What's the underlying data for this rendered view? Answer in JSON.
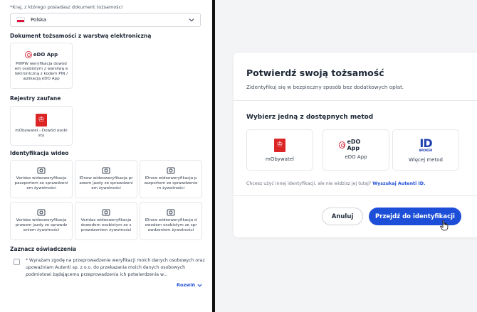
{
  "left": {
    "country_label": "*Kraj, z którego posiadasz dokument tożsamości",
    "country_value": "Polska",
    "section_eid": "Dokument tożsamości z warstwą elektroniczną",
    "edo_tile": {
      "logo_text": "eDO App",
      "text": "PWPW weryfikacja dowod em osobistym z warstwą e lektroniczną z kodem PIN / aplikacją eDO App"
    },
    "section_trusted": "Rejestry zaufane",
    "mobywatel_tile": {
      "text": "mObywatel - Dowód osobi sty"
    },
    "section_video": "Identyfikacja wideo",
    "video_tiles": [
      "Veridas wideoweryfikacja paszportem ze sprawdzeni em żywotności",
      "IDnow wideoweryfikacja pr awem jazdy ze sprawdzeni em żywotności",
      "IDnow wideoweryfikacja p aszportem ze sprawdzenie m żywotności",
      "Veridas wideoweryfikacja prawem jazdy ze sprawdz eniem żywotności",
      "Veridas wideoweryfikacja dowodem osobistym ze s prawdzeniem żywotności",
      "IDnow wideoweryfikacja d owodem osobistym ze spr awdzeniem żywotności"
    ],
    "section_consents": "Zaznacz oświadczenia",
    "consent_text": "* Wyrażam zgodę na przeprowadzenie weryfikacji moich danych osobowych oraz upoważniam Autenti sp. z o.o. do przekazania moich danych osobowych podmiotowi żądającemu przeprowadzenia ich potwierdzenia w...",
    "expand_label": "Rozwiń"
  },
  "modal": {
    "title": "Potwierdź swoją tożsamość",
    "subtitle": "Zidentyfikuj się w bezpieczny sposób bez dodatkowych opłat.",
    "choose_label": "Wybierz jedną z dostępnych metod",
    "methods": [
      {
        "label": "mObywatel"
      },
      {
        "label": "eDO App",
        "logo_text": "eDO App"
      },
      {
        "label": "Więcej metod",
        "logo_big": "ID",
        "logo_small": "BROKER"
      }
    ],
    "other_text": "Chcesz użyć innej identyfikacji, ale nie widzisz jej tutaj?",
    "other_link": "Wyszukaj Autenti ID.",
    "cancel_label": "Anuluj",
    "proceed_label": "Przejdź do identyfikacji"
  },
  "colors": {
    "accent": "#1d4ed8",
    "brand_red": "#dc2626",
    "divider": "#111111"
  },
  "icons": [
    "chevron-down-icon",
    "edo-app-logo",
    "poland-eagle-icon",
    "video-identification-icon",
    "id-broker-logo",
    "hand-pointer-cursor-icon"
  ]
}
